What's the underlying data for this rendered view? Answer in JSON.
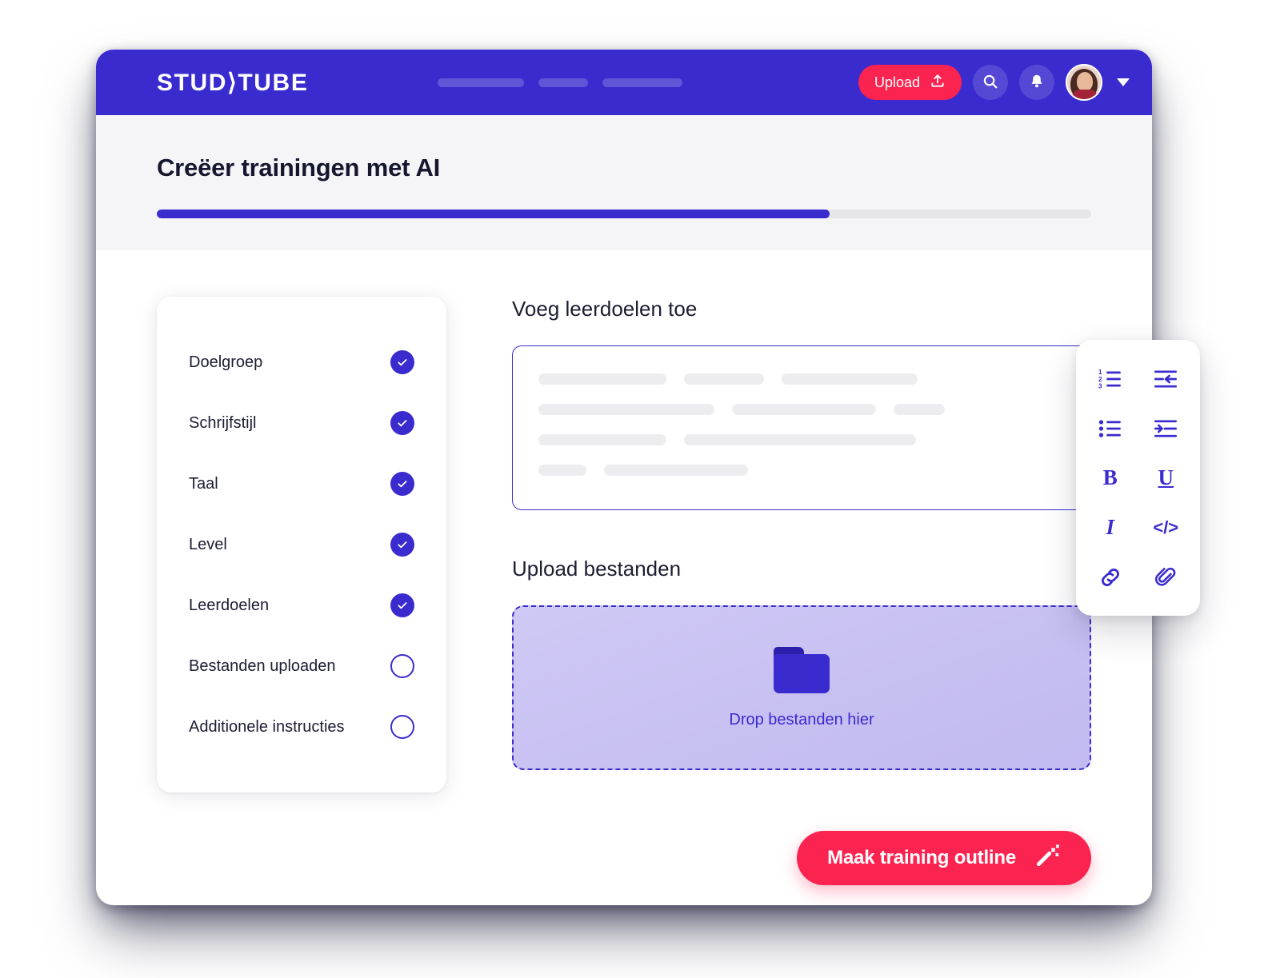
{
  "header": {
    "logo": "STUD⟩TUBE",
    "upload_label": "Upload",
    "upload_icon": "upload-arrow-icon",
    "search_icon": "search-icon",
    "bell_icon": "notification-bell-icon",
    "avatar_icon": "user-avatar",
    "caret_icon": "chevron-down-icon",
    "nav_placeholders": [
      "",
      "",
      ""
    ]
  },
  "page": {
    "title": "Creëer trainingen met AI",
    "progress_percent": 72
  },
  "checklist": {
    "items": [
      {
        "label": "Doelgroep",
        "completed": true
      },
      {
        "label": "Schrijfstijl",
        "completed": true
      },
      {
        "label": "Taal",
        "completed": true
      },
      {
        "label": "Level",
        "completed": true
      },
      {
        "label": "Leerdoelen",
        "completed": true
      },
      {
        "label": "Bestanden uploaden",
        "completed": false
      },
      {
        "label": "Additionele instructies",
        "completed": false
      }
    ]
  },
  "goals": {
    "heading": "Voeg leerdoelen toe",
    "skeleton_rows": [
      [
        160,
        100,
        170
      ],
      [
        220,
        180,
        64
      ],
      [
        160,
        290
      ],
      [
        60,
        180
      ]
    ]
  },
  "upload": {
    "heading": "Upload bestanden",
    "drop_text": "Drop bestanden hier",
    "folder_icon": "folder-icon"
  },
  "cta": {
    "label": "Maak training outline",
    "icon": "magic-wand-icon"
  },
  "format_toolbar": {
    "buttons": [
      {
        "name": "numbered-list-icon",
        "glyph": ""
      },
      {
        "name": "outdent-icon",
        "glyph": ""
      },
      {
        "name": "bullet-list-icon",
        "glyph": ""
      },
      {
        "name": "indent-icon",
        "glyph": ""
      },
      {
        "name": "bold-icon",
        "glyph": "B"
      },
      {
        "name": "underline-icon",
        "glyph": "U"
      },
      {
        "name": "italic-icon",
        "glyph": "I"
      },
      {
        "name": "code-icon",
        "glyph": "</>"
      },
      {
        "name": "link-icon",
        "glyph": ""
      },
      {
        "name": "attachment-icon",
        "glyph": ""
      }
    ]
  },
  "colors": {
    "brand_purple": "#3a2bce",
    "accent_red": "#fb2350",
    "band_grey": "#f5f5f7",
    "skeleton_grey": "#ededf0",
    "dropzone_fill": "#c7c0f2"
  }
}
